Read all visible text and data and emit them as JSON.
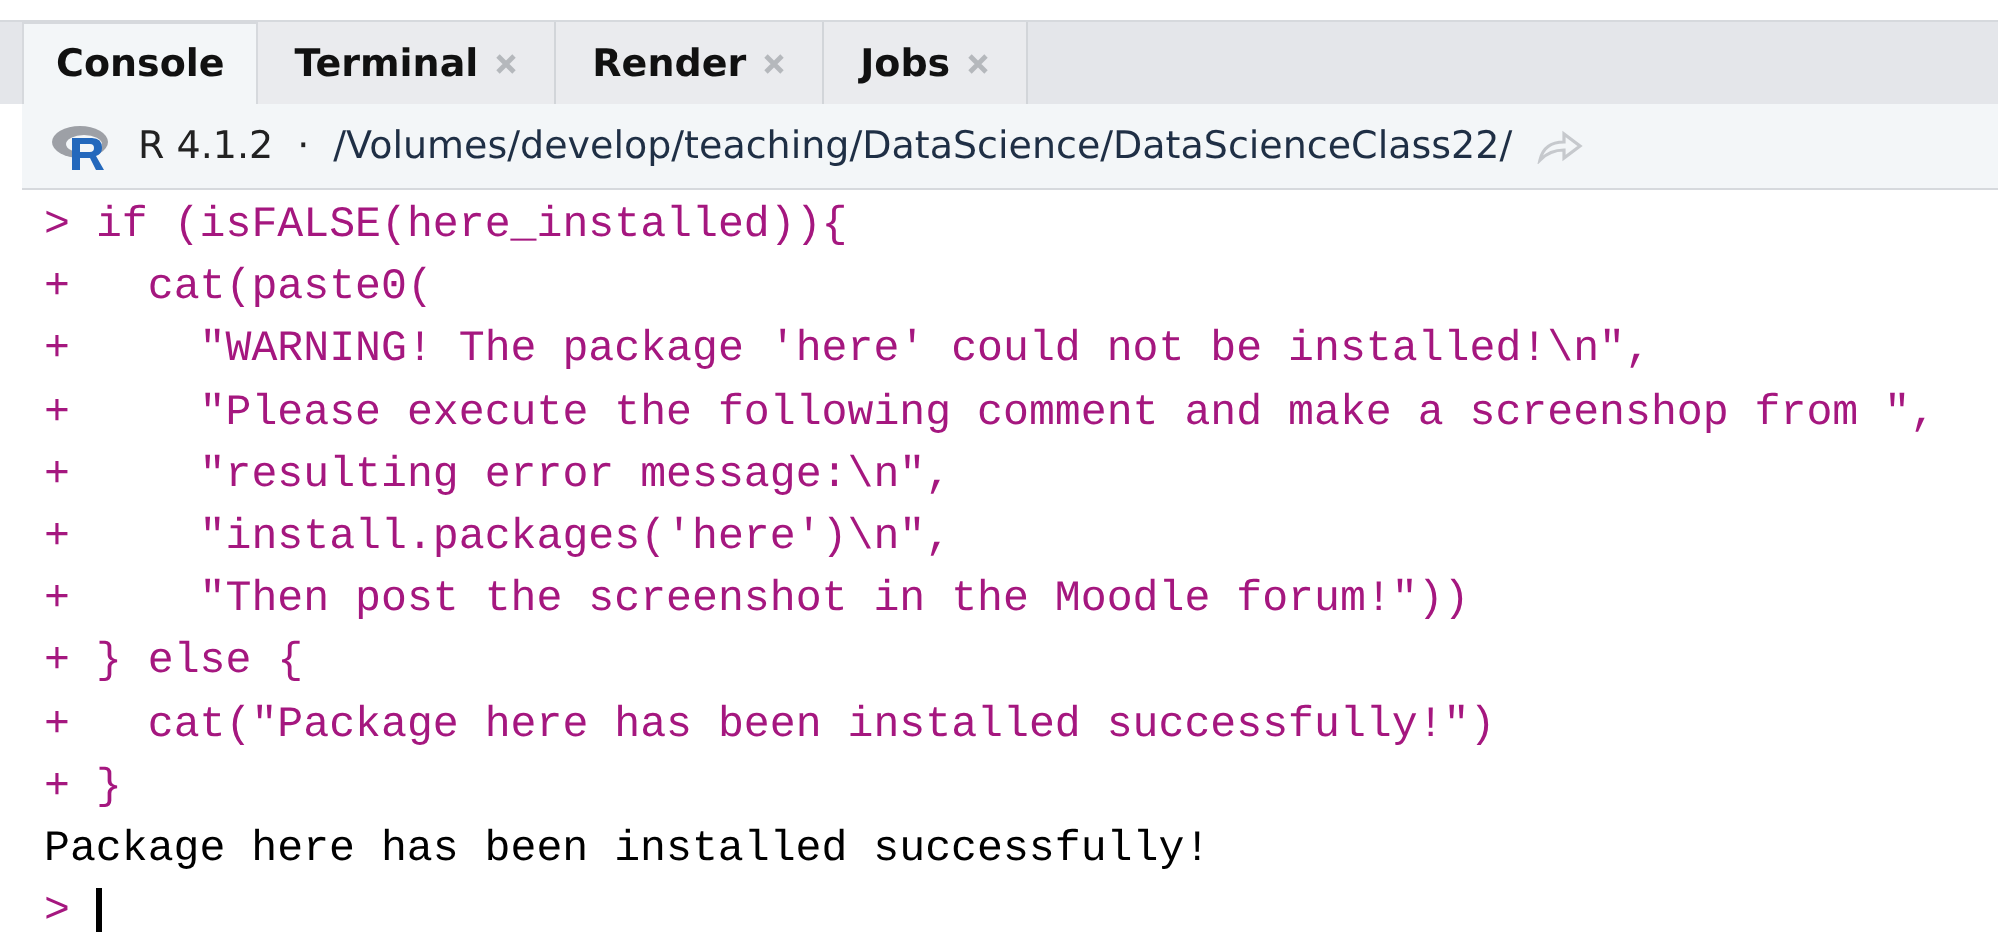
{
  "tabs": [
    {
      "label": "Console",
      "selected": true,
      "closable": false
    },
    {
      "label": "Terminal",
      "selected": false,
      "closable": true
    },
    {
      "label": "Render",
      "selected": false,
      "closable": true
    },
    {
      "label": "Jobs",
      "selected": false,
      "closable": true
    }
  ],
  "header": {
    "version": "R 4.1.2",
    "separator": "·",
    "path": "/Volumes/develop/teaching/DataScience/DataScienceClass22/"
  },
  "console": {
    "lines": [
      {
        "kind": "input",
        "prompt": ">",
        "text": "if (isFALSE(here_installed)){"
      },
      {
        "kind": "input",
        "prompt": "+",
        "text": "  cat(paste0("
      },
      {
        "kind": "input",
        "prompt": "+",
        "text": "    \"WARNING! The package 'here' could not be installed!\\n\","
      },
      {
        "kind": "input",
        "prompt": "+",
        "text": "    \"Please execute the following comment and make a screenshop from \","
      },
      {
        "kind": "input",
        "prompt": "+",
        "text": "    \"resulting error message:\\n\","
      },
      {
        "kind": "input",
        "prompt": "+",
        "text": "    \"install.packages('here')\\n\","
      },
      {
        "kind": "input",
        "prompt": "+",
        "text": "    \"Then post the screenshot in the Moodle forum!\"))"
      },
      {
        "kind": "input",
        "prompt": "+",
        "text": "} else {"
      },
      {
        "kind": "input",
        "prompt": "+",
        "text": "  cat(\"Package here has been installed successfully!\")"
      },
      {
        "kind": "input",
        "prompt": "+",
        "text": "}"
      },
      {
        "kind": "output",
        "text": "Package here has been installed successfully!"
      },
      {
        "kind": "cursor",
        "prompt": ">"
      }
    ]
  }
}
